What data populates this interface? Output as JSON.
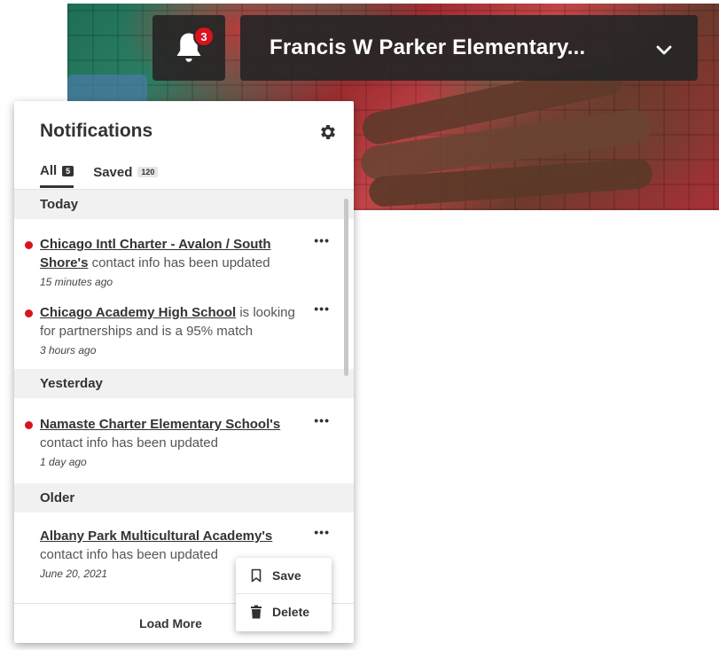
{
  "header": {
    "notification_count": "3",
    "school_name": "Francis W Parker Elementary..."
  },
  "panel": {
    "title": "Notifications",
    "tabs": [
      {
        "label": "All",
        "count": "5"
      },
      {
        "label": "Saved",
        "count": "120"
      }
    ],
    "sections": {
      "today": "Today",
      "yesterday": "Yesterday",
      "older": "Older"
    },
    "items": [
      {
        "link": "Chicago Intl Charter - Avalon / South Shore's",
        "text": " contact info has been updated",
        "time": "15 minutes ago",
        "more": "•••"
      },
      {
        "link": "Chicago Academy High School",
        "text": " is looking for partnerships and is a 95% match",
        "time": "3 hours ago",
        "more": "•••"
      },
      {
        "link": "Namaste Charter Elementary School's",
        "text": " contact info has been updated",
        "time": "1 day ago",
        "more": "•••"
      },
      {
        "link": "Albany Park Multicultural Academy's",
        "text": " contact info has been updated",
        "time": "June 20, 2021",
        "more": "•••"
      }
    ],
    "load_more": "Load More"
  },
  "context_menu": {
    "save": "Save",
    "delete": "Delete"
  },
  "colors": {
    "unread_dot": "#d8141e",
    "header_bg": "#262626"
  }
}
